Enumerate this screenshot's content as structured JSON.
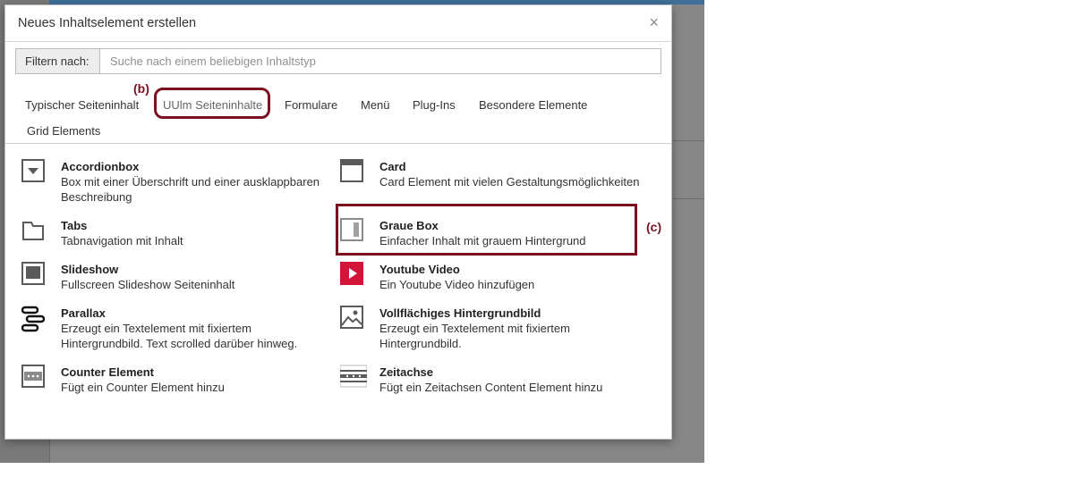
{
  "dialog": {
    "title": "Neues Inhaltselement erstellen",
    "close_symbol": "×"
  },
  "filter": {
    "label": "Filtern nach:",
    "placeholder": "Suche nach einem beliebigen Inhaltstyp"
  },
  "tabs": [
    {
      "label": "Typischer Seiteninhalt"
    },
    {
      "label": "UUlm Seiteninhalte",
      "active": true
    },
    {
      "label": "Formulare"
    },
    {
      "label": "Menü"
    },
    {
      "label": "Plug-Ins"
    },
    {
      "label": "Besondere Elemente"
    },
    {
      "label": "Grid Elements"
    }
  ],
  "annotations": {
    "b": "(b)",
    "c": "(c)",
    "color": "#7b1020"
  },
  "items": [
    {
      "title": "Accordionbox",
      "desc": "Box mit einer Überschrift und einer ausklappbaren Beschreibung",
      "icon": "accordion-icon"
    },
    {
      "title": "Card",
      "desc": "Card Element mit vielen Gestaltungsmöglichkeiten",
      "icon": "card-icon"
    },
    {
      "title": "Tabs",
      "desc": "Tabnavigation mit Inhalt",
      "icon": "tabs-icon"
    },
    {
      "title": "Graue Box",
      "desc": "Einfacher Inhalt mit grauem Hintergrund",
      "icon": "grey-box-icon"
    },
    {
      "title": "Slideshow",
      "desc": "Fullscreen Slideshow Seiteninhalt",
      "icon": "slideshow-icon"
    },
    {
      "title": "Youtube Video",
      "desc": "Ein Youtube Video hinzufügen",
      "icon": "youtube-icon"
    },
    {
      "title": "Parallax",
      "desc": "Erzeugt ein Textelement mit fixiertem Hintergrundbild. Text scrolled darüber hinweg.",
      "icon": "parallax-icon"
    },
    {
      "title": "Vollflächiges Hintergrundbild",
      "desc": "Erzeugt ein Textelement mit fixiertem Hintergrundbild.",
      "icon": "background-image-icon"
    },
    {
      "title": "Counter Element",
      "desc": "Fügt ein Counter Element hinzu",
      "icon": "counter-icon"
    },
    {
      "title": "Zeitachse",
      "desc": "Fügt ein Zeitachsen Content Element hinzu",
      "icon": "timeline-icon"
    }
  ],
  "colors": {
    "overlay": "#878787",
    "topbar": "#3f6f98",
    "youtube_red": "#d3153a",
    "icon_gray": "#5a5a5a"
  }
}
